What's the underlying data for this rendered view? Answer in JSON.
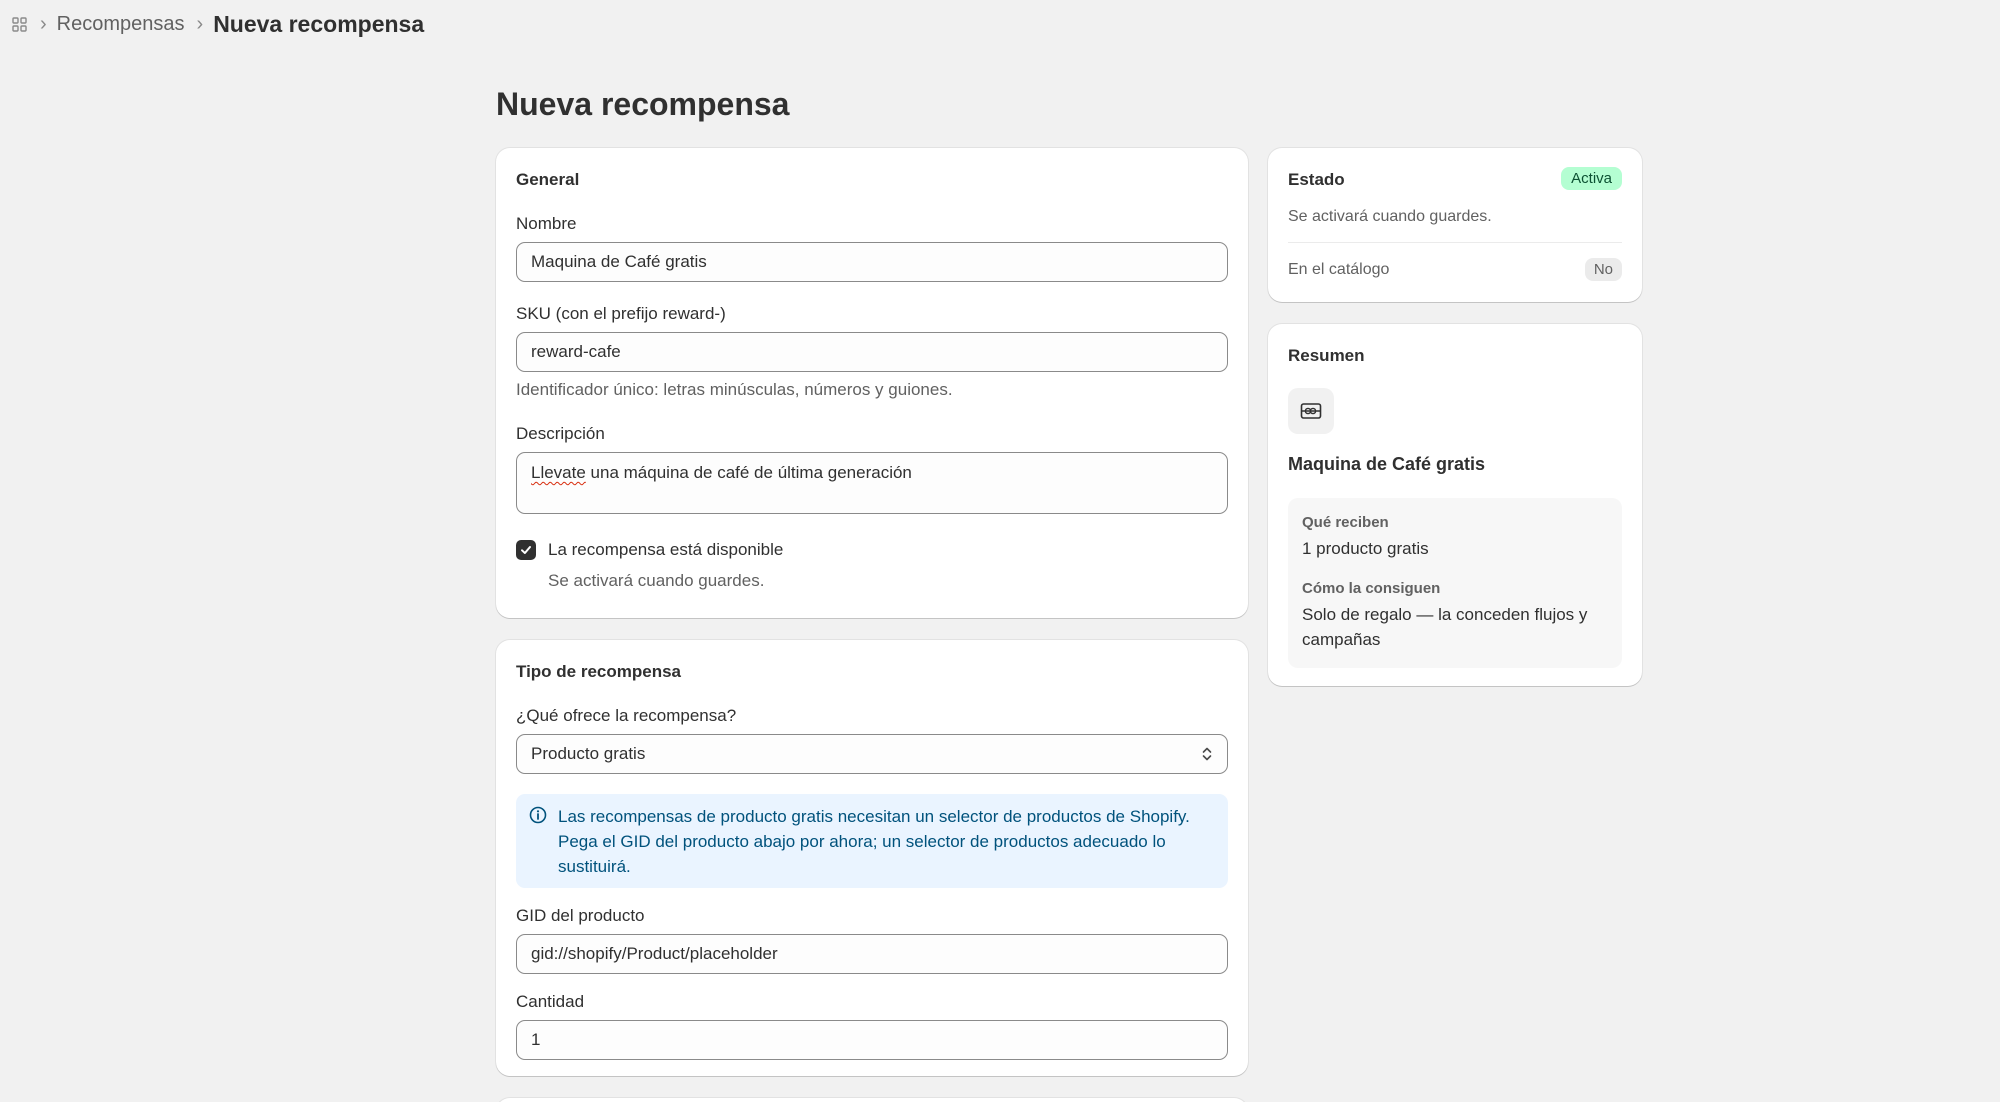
{
  "breadcrumb": {
    "parent": "Recompensas",
    "current": "Nueva recompensa"
  },
  "page": {
    "title": "Nueva recompensa"
  },
  "general": {
    "title": "General",
    "name_label": "Nombre",
    "name_value": "Maquina de Café gratis",
    "sku_label": "SKU (con el prefijo reward-)",
    "sku_value": "reward-cafe",
    "sku_help": "Identificador único: letras minúsculas, números y guiones.",
    "description_label": "Descripción",
    "description_first_word": "Llevate",
    "description_rest": " una máquina de café de última generación",
    "available_label": "La recompensa está disponible",
    "available_checked": true,
    "available_help": "Se activará cuando guardes."
  },
  "reward_type": {
    "title": "Tipo de recompensa",
    "offer_label": "¿Qué ofrece la recompensa?",
    "offer_value": "Producto gratis",
    "banner_text": "Las recompensas de producto gratis necesitan un selector de productos de Shopify. Pega el GID del producto abajo por ahora; un selector de productos adecuado lo sustituirá.",
    "gid_label": "GID del producto",
    "gid_value": "gid://shopify/Product/placeholder",
    "quantity_label": "Cantidad",
    "quantity_value": "1"
  },
  "status": {
    "title": "Estado",
    "badge": "Activa",
    "help": "Se activará cuando guardes.",
    "catalog_label": "En el catálogo",
    "catalog_value": "No"
  },
  "summary": {
    "title": "Resumen",
    "reward_name": "Maquina de Café gratis",
    "receive_label": "Qué reciben",
    "receive_value": "1 producto gratis",
    "how_label": "Cómo la consiguen",
    "how_value": "Solo de regalo — la conceden flujos y campañas"
  },
  "colors": {
    "background": "#f1f1f1",
    "badge_active_bg": "#b4fed2",
    "banner_bg": "#eaf4ff",
    "banner_text": "#00527c"
  }
}
